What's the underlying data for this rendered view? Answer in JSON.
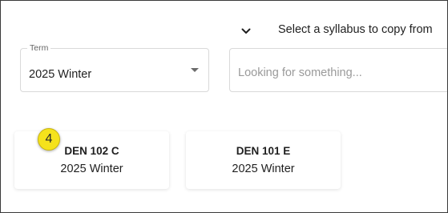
{
  "header": {
    "toggle_icon": "chevron-down-icon",
    "title": "Select a syllabus to copy from"
  },
  "term_select": {
    "label": "Term",
    "value": "2025 Winter",
    "icon": "caret-down-icon"
  },
  "search": {
    "placeholder": "Looking for something...",
    "value": ""
  },
  "courses": [
    {
      "code": "DEN 102 C",
      "term": "2025 Winter"
    },
    {
      "code": "DEN 101 E",
      "term": "2025 Winter"
    }
  ],
  "annotation": {
    "step_number": "4",
    "color": "#f5e21c"
  }
}
